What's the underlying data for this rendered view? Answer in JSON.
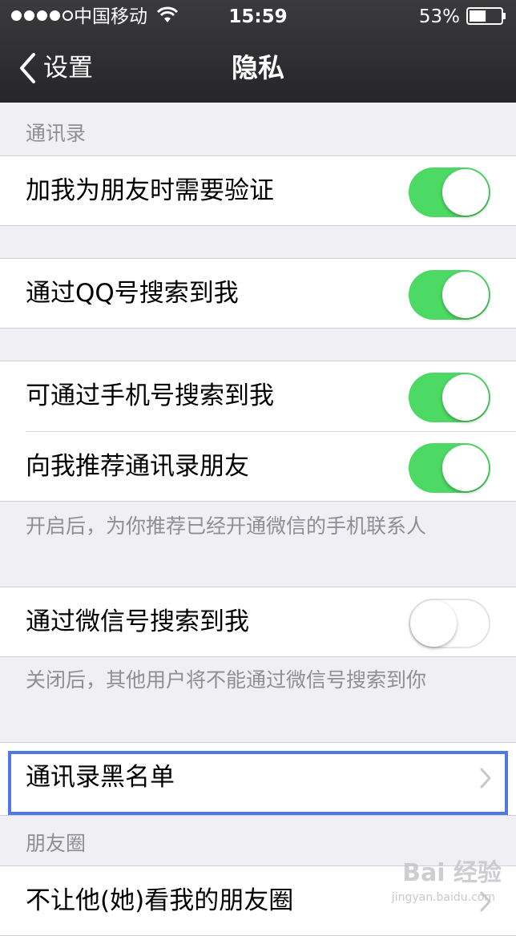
{
  "status_bar": {
    "signal_bars": 4,
    "signal_total": 5,
    "carrier": "中国移动",
    "time": "15:59",
    "battery_percent": "53%",
    "battery_level": 0.53
  },
  "nav": {
    "back_label": "设置",
    "title": "隐私"
  },
  "sections": {
    "contacts_header": "通讯录",
    "verify_label": "加我为朋友时需要验证",
    "verify_on": true,
    "qq_search_label": "通过QQ号搜索到我",
    "qq_search_on": true,
    "phone_search_label": "可通过手机号搜索到我",
    "phone_search_on": true,
    "recommend_label": "向我推荐通讯录朋友",
    "recommend_on": true,
    "recommend_note": "开启后，为你推荐已经开通微信的手机联系人",
    "wechat_id_search_label": "通过微信号搜索到我",
    "wechat_id_search_on": false,
    "wechat_id_note": "关闭后，其他用户将不能通过微信号搜索到你",
    "blacklist_label": "通讯录黑名单",
    "moments_header": "朋友圈",
    "moments_hide_label": "不让他(她)看我的朋友圈"
  },
  "watermark": {
    "text": "Bai 经验",
    "sub": "jingyan.baidu.com"
  },
  "colors": {
    "toggle_on": "#4cd964",
    "highlight": "#4f79e2",
    "background": "#efeff4"
  }
}
